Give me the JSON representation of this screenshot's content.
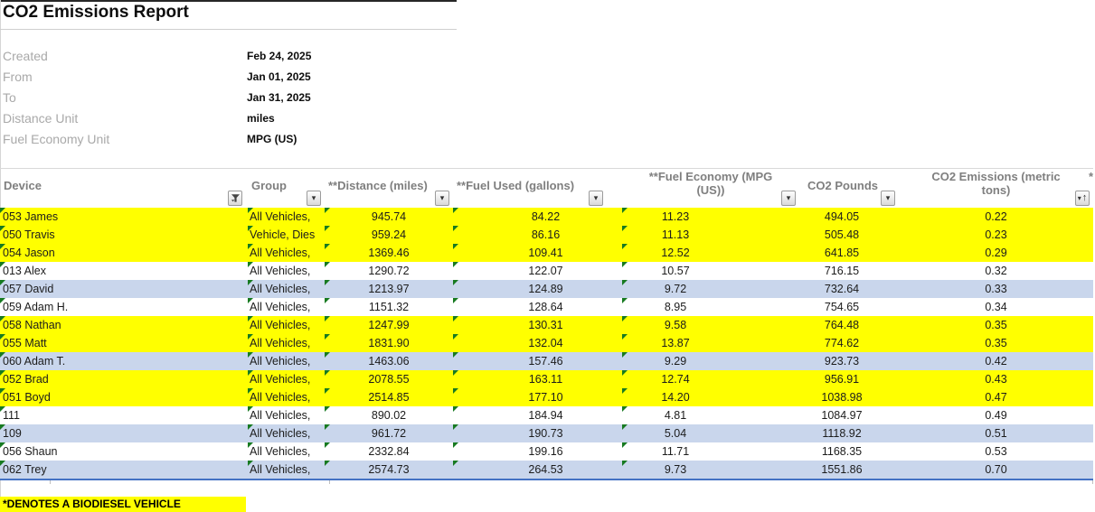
{
  "title": "CO2 Emissions Report",
  "meta": {
    "rows": [
      {
        "label": "Created",
        "value": "Feb 24, 2025"
      },
      {
        "label": "From",
        "value": "Jan 01, 2025"
      },
      {
        "label": "To",
        "value": "Jan 31, 2025"
      },
      {
        "label": "Distance Unit",
        "value": "miles"
      },
      {
        "label": "Fuel Economy Unit",
        "value": "MPG (US)"
      }
    ]
  },
  "table": {
    "columns": [
      {
        "label": "Device",
        "control": "funnel",
        "twoLine": false
      },
      {
        "label": "Group",
        "control": "dd",
        "twoLine": false
      },
      {
        "label": "**Distance (miles)",
        "control": "dd",
        "twoLine": false
      },
      {
        "label": "**Fuel Used (gallons)",
        "control": "dd",
        "twoLine": false
      },
      {
        "label": "**Fuel Economy (MPG\n(US))",
        "control": "dd",
        "twoLine": true
      },
      {
        "label": "CO2 Pounds",
        "control": "dd",
        "twoLine": false
      },
      {
        "label": "CO2 Emissions (metric\ntons)",
        "control": "sort",
        "twoLine": true
      }
    ],
    "clipped_next_column_label": "*",
    "rows": [
      {
        "device": "053 James",
        "group": "All Vehicles,",
        "distance": "945.74",
        "fuel_used": "84.22",
        "fuel_economy": "11.23",
        "co2_pounds": "494.05",
        "co2_tons": "0.22",
        "highlight": "yellow"
      },
      {
        "device": "050 Travis",
        "group": "Vehicle, Dies",
        "distance": "959.24",
        "fuel_used": "86.16",
        "fuel_economy": "11.13",
        "co2_pounds": "505.48",
        "co2_tons": "0.23",
        "highlight": "yellow"
      },
      {
        "device": "054 Jason",
        "group": "All Vehicles,",
        "distance": "1369.46",
        "fuel_used": "109.41",
        "fuel_economy": "12.52",
        "co2_pounds": "641.85",
        "co2_tons": "0.29",
        "highlight": "yellow"
      },
      {
        "device": "013 Alex",
        "group": "All Vehicles,",
        "distance": "1290.72",
        "fuel_used": "122.07",
        "fuel_economy": "10.57",
        "co2_pounds": "716.15",
        "co2_tons": "0.32",
        "highlight": "white"
      },
      {
        "device": "057 David",
        "group": "All Vehicles,",
        "distance": "1213.97",
        "fuel_used": "124.89",
        "fuel_economy": "9.72",
        "co2_pounds": "732.64",
        "co2_tons": "0.33",
        "highlight": "blue"
      },
      {
        "device": "059 Adam H.",
        "group": "All Vehicles,",
        "distance": "1151.32",
        "fuel_used": "128.64",
        "fuel_economy": "8.95",
        "co2_pounds": "754.65",
        "co2_tons": "0.34",
        "highlight": "white"
      },
      {
        "device": "058 Nathan",
        "group": "All Vehicles,",
        "distance": "1247.99",
        "fuel_used": "130.31",
        "fuel_economy": "9.58",
        "co2_pounds": "764.48",
        "co2_tons": "0.35",
        "highlight": "yellow"
      },
      {
        "device": "055 Matt",
        "group": "All Vehicles,",
        "distance": "1831.90",
        "fuel_used": "132.04",
        "fuel_economy": "13.87",
        "co2_pounds": "774.62",
        "co2_tons": "0.35",
        "highlight": "yellow"
      },
      {
        "device": "060 Adam T.",
        "group": "All Vehicles,",
        "distance": "1463.06",
        "fuel_used": "157.46",
        "fuel_economy": "9.29",
        "co2_pounds": "923.73",
        "co2_tons": "0.42",
        "highlight": "blue"
      },
      {
        "device": "052 Brad",
        "group": "All Vehicles,",
        "distance": "2078.55",
        "fuel_used": "163.11",
        "fuel_economy": "12.74",
        "co2_pounds": "956.91",
        "co2_tons": "0.43",
        "highlight": "yellow"
      },
      {
        "device": "051 Boyd",
        "group": "All Vehicles,",
        "distance": "2514.85",
        "fuel_used": "177.10",
        "fuel_economy": "14.20",
        "co2_pounds": "1038.98",
        "co2_tons": "0.47",
        "highlight": "yellow"
      },
      {
        "device": "111",
        "group": "All Vehicles,",
        "distance": "890.02",
        "fuel_used": "184.94",
        "fuel_economy": "4.81",
        "co2_pounds": "1084.97",
        "co2_tons": "0.49",
        "highlight": "white"
      },
      {
        "device": "109",
        "group": "All Vehicles,",
        "distance": "961.72",
        "fuel_used": "190.73",
        "fuel_economy": "5.04",
        "co2_pounds": "1118.92",
        "co2_tons": "0.51",
        "highlight": "blue"
      },
      {
        "device": "056 Shaun",
        "group": "All Vehicles,",
        "distance": "2332.84",
        "fuel_used": "199.16",
        "fuel_economy": "11.71",
        "co2_pounds": "1168.35",
        "co2_tons": "0.53",
        "highlight": "white"
      },
      {
        "device": "062 Trey",
        "group": "All Vehicles,",
        "distance": "2574.73",
        "fuel_used": "264.53",
        "fuel_economy": "9.73",
        "co2_pounds": "1551.86",
        "co2_tons": "0.70",
        "highlight": "blue"
      }
    ]
  },
  "footnote": "*DENOTES A BIODIESEL VEHICLE",
  "colors": {
    "row_yellow": "#FFFF00",
    "row_blue": "#C9D6EC",
    "table_bottom_border": "#4472C4",
    "error_indicator_green": "#177A21",
    "header_text": "#7F7F7F",
    "meta_label_gray": "#A9A9A9"
  }
}
